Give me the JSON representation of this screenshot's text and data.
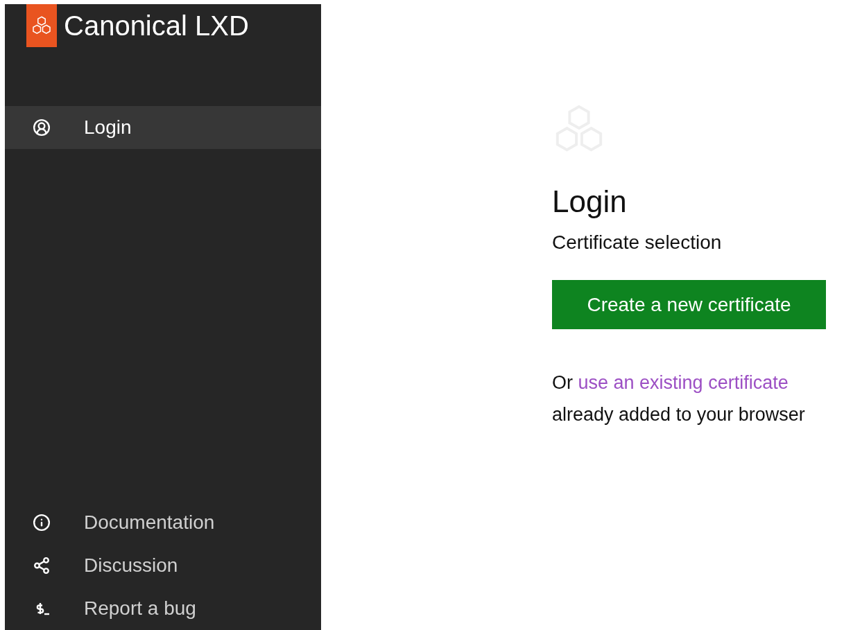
{
  "sidebar": {
    "brand": "Canonical LXD",
    "items": [
      {
        "label": "Login",
        "selected": true,
        "kind": "user"
      }
    ],
    "footer_items": [
      {
        "label": "Documentation",
        "kind": "info"
      },
      {
        "label": "Discussion",
        "kind": "share"
      },
      {
        "label": "Report a bug",
        "kind": "terminal"
      }
    ]
  },
  "main": {
    "title": "Login",
    "subtitle": "Certificate selection",
    "button": "Create a new certificate",
    "note": {
      "before": "Or",
      "link": "use an existing certificate",
      "after": "already added to your browser"
    }
  }
}
